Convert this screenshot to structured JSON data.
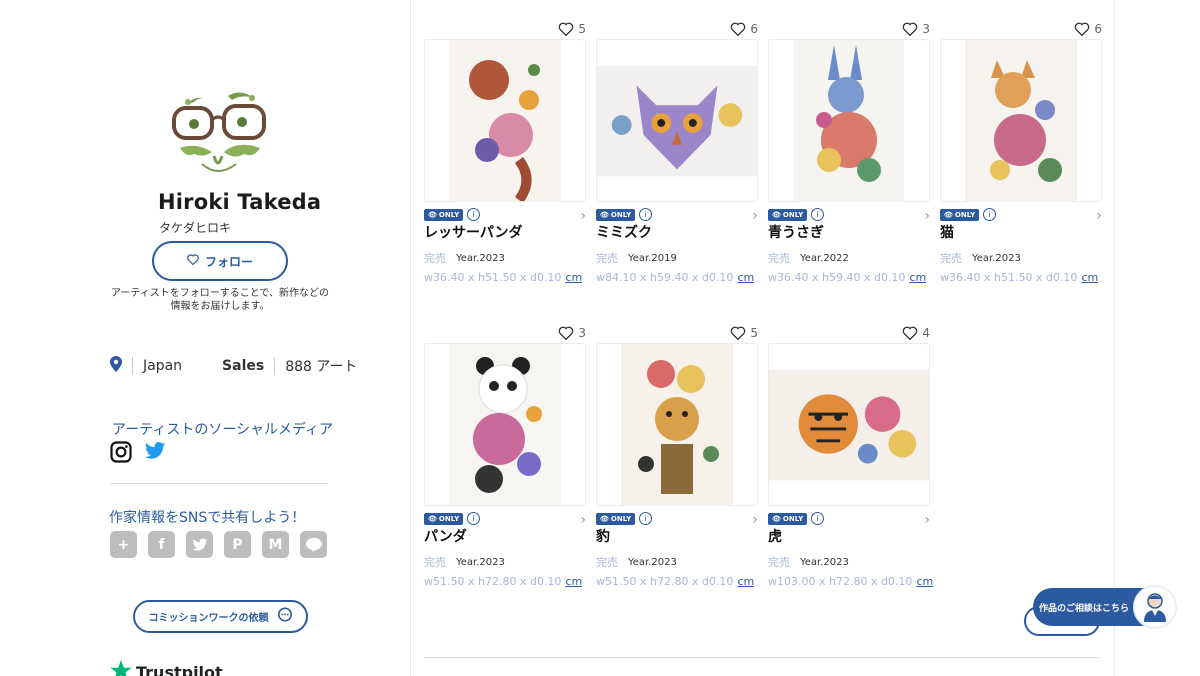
{
  "artist": {
    "name": "Hiroki Takeda",
    "kana": "タケダヒロキ",
    "follow_label": "フォロー",
    "follow_note": "アーティストをフォローすることで、新作などの情報をお届けします。",
    "location": "Japan",
    "sales_label": "Sales",
    "sales_value": "888 アート"
  },
  "social": {
    "title": "アーティストのソーシャルメディア",
    "icons": [
      "instagram-icon",
      "twitter-icon"
    ]
  },
  "share": {
    "title": "作家情報をSNSで共有しよう！",
    "icons": [
      "plus-icon",
      "facebook-icon",
      "twitter-icon",
      "pinterest-icon",
      "gmail-icon",
      "line-icon"
    ]
  },
  "commission_label": "コミッションワークの依頼",
  "trustpilot_label": "Trustpilot",
  "badge_label": "ONLY",
  "artworks": [
    {
      "title": "レッサーパンダ",
      "likes": "5",
      "status": "完売",
      "year": "Year.2023",
      "dims": "w36.40 x h51.50 x d0.10",
      "unit": "cm"
    },
    {
      "title": "ミミズク",
      "likes": "6",
      "status": "完売",
      "year": "Year.2019",
      "dims": "w84.10 x h59.40 x d0.10",
      "unit": "cm"
    },
    {
      "title": "青うさぎ",
      "likes": "3",
      "status": "完売",
      "year": "Year.2022",
      "dims": "w36.40 x h59.40 x d0.10",
      "unit": "cm"
    },
    {
      "title": "猫",
      "likes": "6",
      "status": "完売",
      "year": "Year.2023",
      "dims": "w36.40 x h51.50 x d0.10",
      "unit": "cm"
    },
    {
      "title": "パンダ",
      "likes": "3",
      "status": "完売",
      "year": "Year.2023",
      "dims": "w51.50 x h72.80 x d0.10",
      "unit": "cm"
    },
    {
      "title": "豹",
      "likes": "5",
      "status": "完売",
      "year": "Year.2023",
      "dims": "w51.50 x h72.80 x d0.10",
      "unit": "cm"
    },
    {
      "title": "虎",
      "likes": "4",
      "status": "完売",
      "year": "Year.2023",
      "dims": "w103.00 x h72.80 x d0.10",
      "unit": "cm"
    }
  ],
  "chat_label": "作品のご相談はこちら",
  "colors": {
    "accent": "#2c5aa0",
    "muted": "#a8b6d6"
  }
}
